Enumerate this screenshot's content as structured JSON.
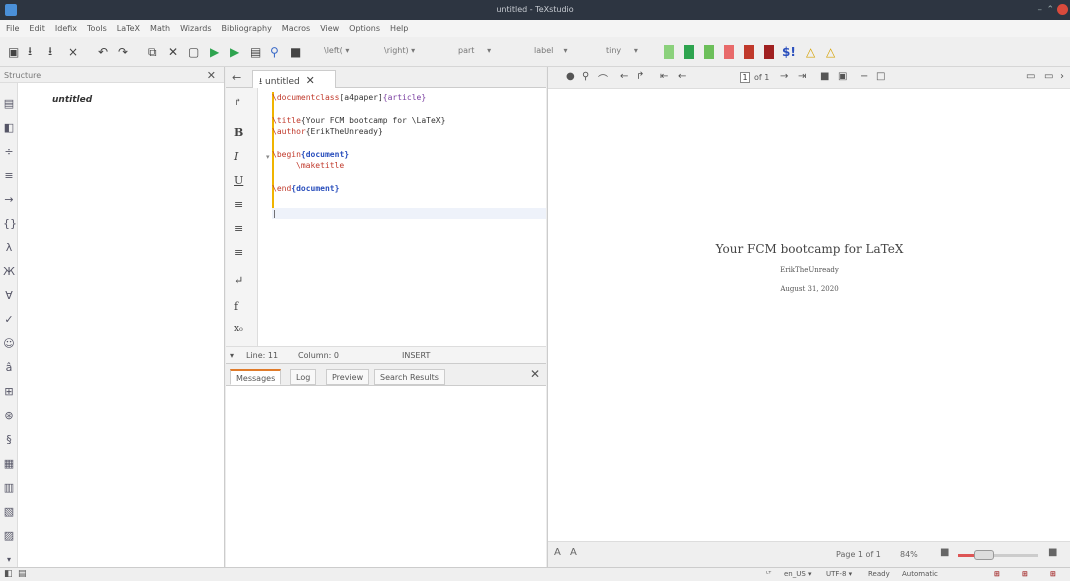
{
  "window": {
    "title": "untitled - TeXstudio"
  },
  "menu": [
    "File",
    "Edit",
    "Idefix",
    "Tools",
    "LaTeX",
    "Math",
    "Wizards",
    "Bibliography",
    "Macros",
    "View",
    "Options",
    "Help"
  ],
  "toolbar": {
    "left_delim": "\\left(",
    "right_delim": "\\right)",
    "section": "part",
    "label": "label",
    "size": "tiny"
  },
  "structure": {
    "header": "Structure",
    "item": "untitled"
  },
  "editor": {
    "tab_label": "untitled",
    "code_lines": [
      {
        "cmd": "\\documentclass",
        "arg1": "[a4paper]",
        "arg2": "{article}"
      },
      {
        "cmd": "\\title",
        "arg1": "{Your FCM bootcamp for \\LaTeX}",
        "arg2": ""
      },
      {
        "cmd": "\\author",
        "arg1": "{ErikTheUnready}",
        "arg2": ""
      },
      {
        "cmd": "\\begin",
        "arg1": "{document}",
        "arg2": ""
      },
      {
        "cmd": "\\maketitle",
        "arg1": "",
        "arg2": ""
      },
      {
        "cmd": "\\end",
        "arg1": "{document}",
        "arg2": ""
      }
    ],
    "status": {
      "line": "Line: 11",
      "column": "Column: 0",
      "mode": "INSERT"
    }
  },
  "messages": {
    "tabs": [
      "Messages",
      "Log",
      "Preview",
      "Search Results"
    ]
  },
  "viewer": {
    "page_number": "1",
    "page_of": "of 1",
    "document": {
      "title": "Your FCM bootcamp for LaTeX",
      "author": "ErikTheUnready",
      "date": "August 31, 2020"
    },
    "page_status": "Page 1 of 1",
    "zoom": "84%"
  },
  "statusbar": {
    "language": "en_US",
    "encoding": "UTF-8",
    "state": "Ready",
    "mode": "Automatic"
  },
  "colors": {
    "accent_orange": "#e07b2a",
    "run_green": "#2ea44f",
    "titlebar": "#2d3541"
  }
}
